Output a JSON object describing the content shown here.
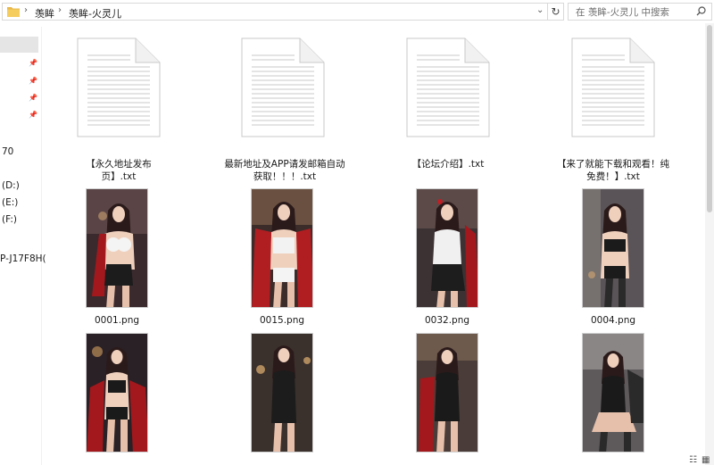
{
  "address": {
    "crumbs": [
      "羡眸",
      "羡眸-火灵儿"
    ],
    "search_placeholder": "在 羡眸-火灵儿 中搜索"
  },
  "nav": {
    "labels": [
      "70",
      "(D:)",
      "(E:)",
      "(F:)",
      "P-J17F8H("
    ]
  },
  "files": [
    {
      "name": "【永久地址发布页】.txt",
      "type": "txt"
    },
    {
      "name": "最新地址及APP请发邮箱自动获取！！！.txt",
      "type": "txt"
    },
    {
      "name": "【论坛介绍】.txt",
      "type": "txt"
    },
    {
      "name": "【来了就能下载和观看！纯免费！】.txt",
      "type": "txt"
    },
    {
      "name": "0001.png",
      "type": "png"
    },
    {
      "name": "0015.png",
      "type": "png"
    },
    {
      "name": "0032.png",
      "type": "png"
    },
    {
      "name": "0004.png",
      "type": "png"
    },
    {
      "name": "",
      "type": "png"
    },
    {
      "name": "",
      "type": "png"
    },
    {
      "name": "",
      "type": "png"
    },
    {
      "name": "",
      "type": "png"
    }
  ],
  "colors": {
    "folder": "#e8b84a",
    "selection": "#e5e5e5",
    "thumb_dark": "#2a2126",
    "thumb_red": "#a3181c"
  }
}
